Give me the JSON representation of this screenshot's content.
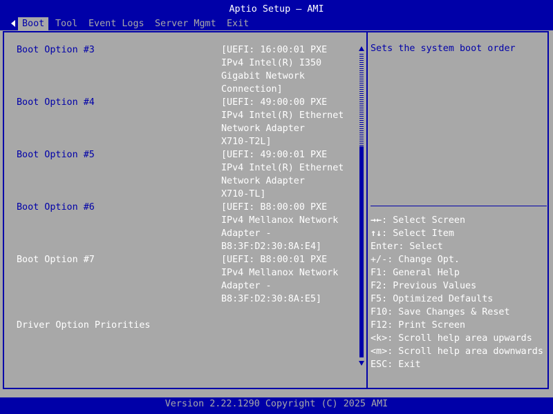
{
  "header": {
    "title": "Aptio Setup – AMI",
    "tabs": [
      {
        "label": "Boot"
      },
      {
        "label": "Tool"
      },
      {
        "label": "Event Logs"
      },
      {
        "label": "Server Mgmt"
      },
      {
        "label": "Exit"
      }
    ]
  },
  "main": {
    "rows": [
      {
        "label": "Boot Option #3",
        "value_lines": [
          "[UEFI: 16:00:01 PXE",
          "IPv4 Intel(R) I350",
          "Gigabit Network",
          "Connection]"
        ]
      },
      {
        "label": "Boot Option #4",
        "value_lines": [
          "[UEFI: 49:00:00 PXE",
          "IPv4 Intel(R) Ethernet",
          "Network Adapter",
          "X710-T2L]"
        ]
      },
      {
        "label": "Boot Option #5",
        "value_lines": [
          "[UEFI: 49:00:01 PXE",
          "IPv4 Intel(R) Ethernet",
          "Network Adapter",
          "X710-TL]"
        ]
      },
      {
        "label": "Boot Option #6",
        "value_lines": [
          "[UEFI: B8:00:00 PXE",
          "IPv4 Mellanox Network",
          "Adapter -",
          "B8:3F:D2:30:8A:E4]"
        ]
      },
      {
        "label": "Boot Option #7",
        "value_lines": [
          "[UEFI: B8:00:01 PXE",
          "IPv4 Mellanox Network",
          "Adapter -",
          "B8:3F:D2:30:8A:E5]"
        ]
      }
    ],
    "driver_option_priorities": "Driver Option Priorities"
  },
  "help": {
    "text": "Sets the system boot order",
    "keys": [
      {
        "key": "→←",
        "desc": ": Select Screen"
      },
      {
        "key": "↑↓",
        "desc": ": Select Item"
      },
      {
        "key": "Enter",
        "desc": ": Select"
      },
      {
        "key": "+/-",
        "desc": ": Change Opt."
      },
      {
        "key": "F1",
        "desc": ": General Help"
      },
      {
        "key": "F2",
        "desc": ": Previous Values"
      },
      {
        "key": "F5",
        "desc": ": Optimized Defaults"
      },
      {
        "key": "F10",
        "desc": ": Save Changes & Reset"
      },
      {
        "key": "F12",
        "desc": ": Print Screen"
      },
      {
        "key": "<k>",
        "desc": ": Scroll help area upwards"
      },
      {
        "key": "<m>",
        "desc": ": Scroll help area downwards"
      },
      {
        "key": "ESC",
        "desc": ": Exit"
      }
    ]
  },
  "footer": {
    "version": "Version 2.22.1290 Copyright (C) 2025 AMI"
  },
  "colors": {
    "bios_blue": "#0000a8",
    "bios_gray": "#a8a8a8",
    "text_white": "#ffffff"
  },
  "icons": [
    "left-arrow-icon",
    "scroll-up-arrow-icon",
    "scroll-down-arrow-icon"
  ]
}
